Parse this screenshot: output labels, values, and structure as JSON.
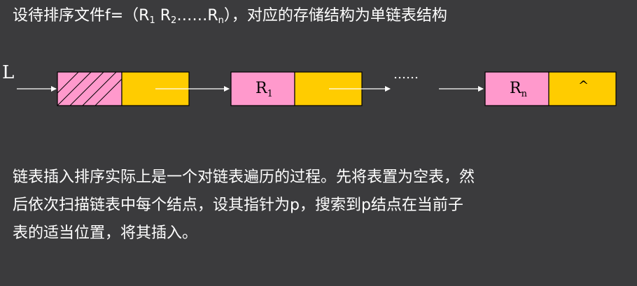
{
  "title": {
    "prefix": "设待排序文件f=（R",
    "sub1": "1",
    "mid1": " R",
    "sub2": "2",
    "mid2": "……R",
    "sub3": "n",
    "suffix": "），对应的存储结构为单链表结构"
  },
  "diagram": {
    "head_label": "L",
    "node1_label": "R",
    "node1_sub": "1",
    "ellipsis": "……",
    "node_n_label": "R",
    "node_n_sub": "n",
    "null_symbol": "^"
  },
  "paragraph": {
    "line1": "链表插入排序实际上是一个对链表遍历的过程。先将表置为空表，然",
    "line2": "后依次扫描链表中每个结点，设其指针为p，搜索到p结点在当前子",
    "line3": "表的适当位置，将其插入。"
  },
  "colors": {
    "background": "#3b3b3d",
    "data_field": "#ff99cc",
    "pointer_field": "#ffcc00"
  }
}
